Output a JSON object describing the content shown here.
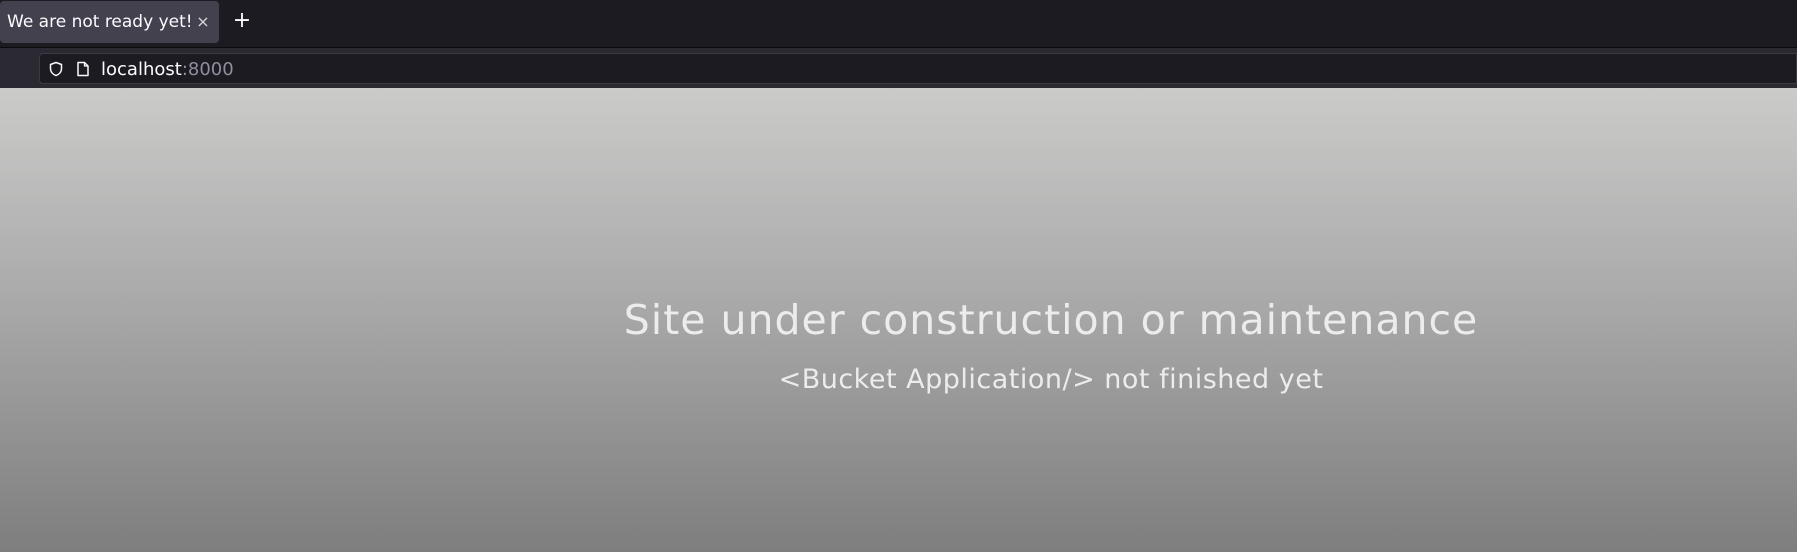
{
  "browser": {
    "tab": {
      "title": "We are not ready yet!",
      "close_symbol": "×"
    },
    "new_tab_symbol": "+",
    "urlbar": {
      "host": "localhost",
      "port": ":8000",
      "icons": [
        "shield-icon",
        "page-icon"
      ]
    }
  },
  "page": {
    "headline": "Site under construction or maintenance",
    "subline": "<Bucket Application/> not finished yet"
  },
  "colors": {
    "tabbar_bg": "#1c1b22",
    "tab_active_bg": "#42414d",
    "navbar_bg": "#2b2a33",
    "page_gradient_top": "#cbcbca",
    "page_gradient_bottom": "#7d7e7d",
    "page_text": "#ececec"
  }
}
